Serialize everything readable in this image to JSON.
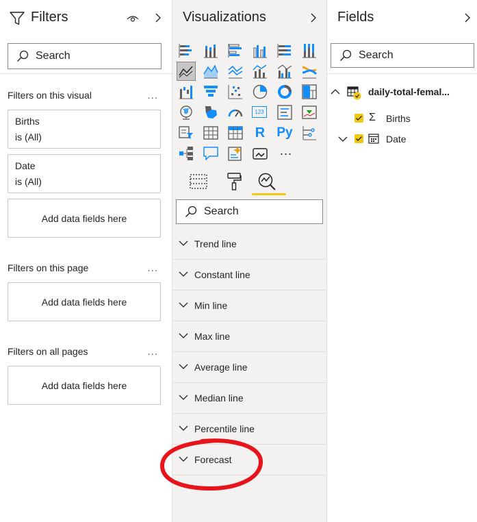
{
  "filters": {
    "title": "Filters",
    "search_placeholder": "Search",
    "visual_section": "Filters on this visual",
    "visual_cards": [
      {
        "field": "Births",
        "value": "is (All)"
      },
      {
        "field": "Date",
        "value": "is (All)"
      }
    ],
    "add_fields": "Add data fields here",
    "page_section": "Filters on this page",
    "all_pages_section": "Filters on all pages",
    "more": "..."
  },
  "visualizations": {
    "title": "Visualizations",
    "more_visuals": "...",
    "r_label": "R",
    "py_label": "Py",
    "num_label": "123",
    "search_placeholder": "Search",
    "analytics_items": [
      "Trend line",
      "Constant line",
      "Min line",
      "Max line",
      "Average line",
      "Median line",
      "Percentile line",
      "Forecast"
    ]
  },
  "fields_pane": {
    "title": "Fields",
    "search_placeholder": "Search",
    "table_name": "daily-total-femal...",
    "fields": [
      {
        "name": "Births",
        "type": "sigma"
      },
      {
        "name": "Date",
        "type": "calendar"
      }
    ]
  },
  "colors": {
    "accent_yellow": "#f2c811",
    "icon_blue": "#118dff",
    "annotation_red": "#e8141b"
  }
}
